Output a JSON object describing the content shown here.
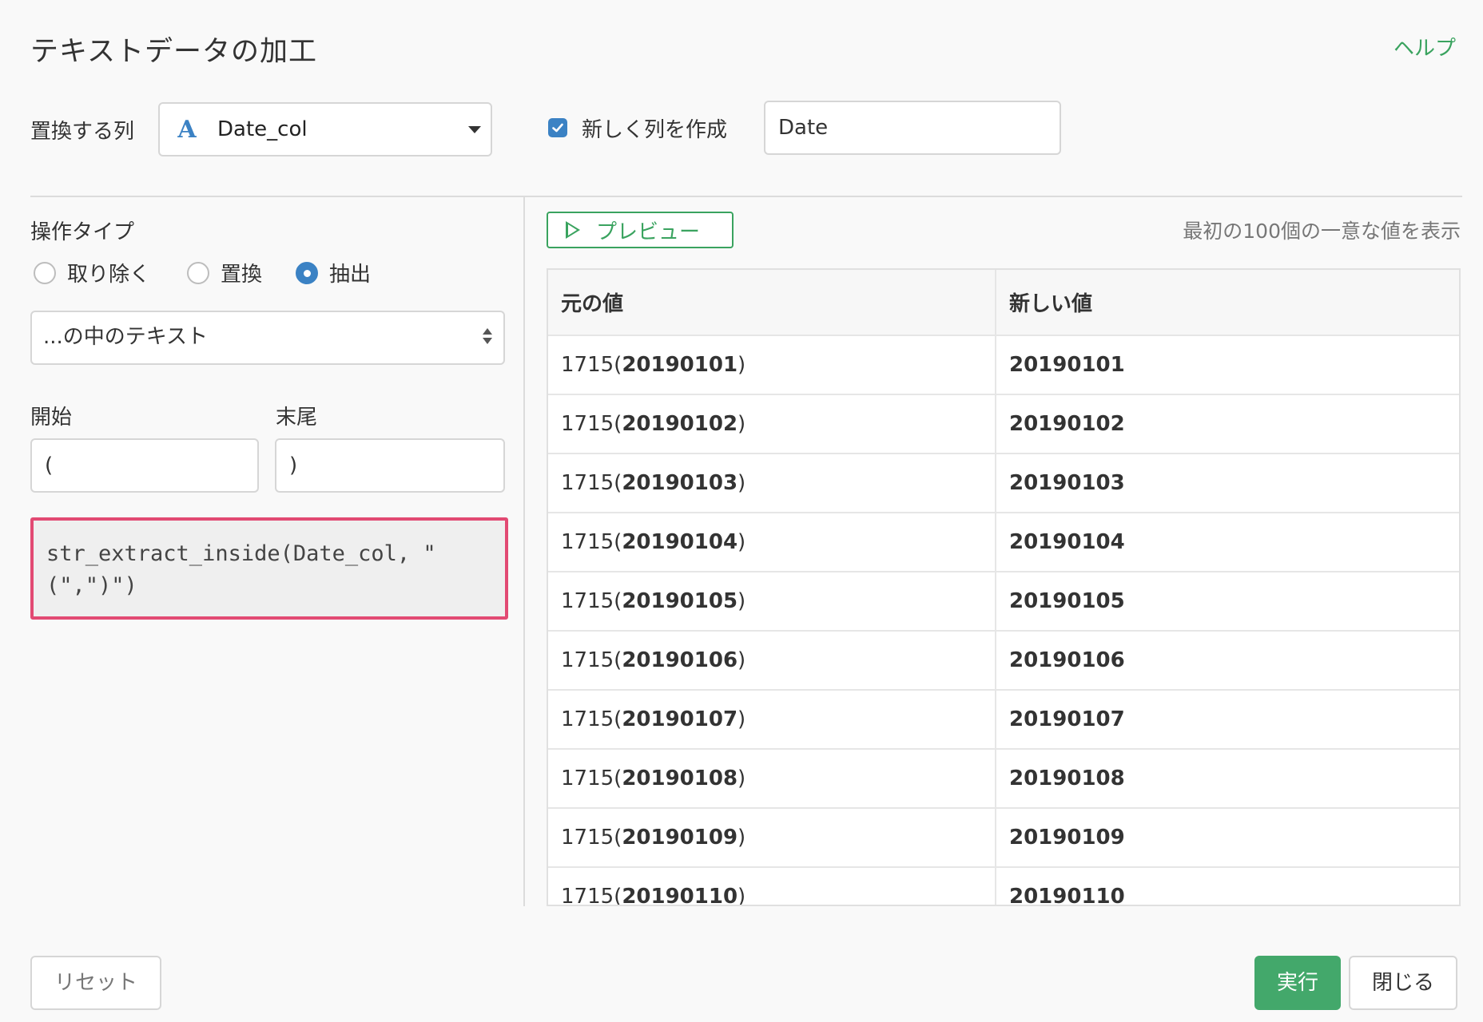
{
  "dialog": {
    "title": "テキストデータの加工",
    "help_label": "ヘルプ"
  },
  "replace_column": {
    "label": "置換する列",
    "type_icon": "A",
    "selected": "Date_col"
  },
  "new_column": {
    "checked": true,
    "label": "新しく列を作成",
    "value": "Date"
  },
  "operation": {
    "label": "操作タイプ",
    "options": [
      {
        "label": "取り除く",
        "selected": false
      },
      {
        "label": "置換",
        "selected": false
      },
      {
        "label": "抽出",
        "selected": true
      }
    ],
    "mode_selected": "...の中のテキスト"
  },
  "range": {
    "start_label": "開始",
    "start_value": "(",
    "end_label": "末尾",
    "end_value": ")"
  },
  "code": "str_extract_inside(Date_col, \"(\",\")\")",
  "preview": {
    "button_label": "プレビュー",
    "note": "最初の100個の一意な値を表示",
    "columns": [
      "元の値",
      "新しい値"
    ],
    "rows": [
      {
        "prefix": "1715(",
        "inner": "20190101",
        "suffix": ")",
        "new": "20190101"
      },
      {
        "prefix": "1715(",
        "inner": "20190102",
        "suffix": ")",
        "new": "20190102"
      },
      {
        "prefix": "1715(",
        "inner": "20190103",
        "suffix": ")",
        "new": "20190103"
      },
      {
        "prefix": "1715(",
        "inner": "20190104",
        "suffix": ")",
        "new": "20190104"
      },
      {
        "prefix": "1715(",
        "inner": "20190105",
        "suffix": ")",
        "new": "20190105"
      },
      {
        "prefix": "1715(",
        "inner": "20190106",
        "suffix": ")",
        "new": "20190106"
      },
      {
        "prefix": "1715(",
        "inner": "20190107",
        "suffix": ")",
        "new": "20190107"
      },
      {
        "prefix": "1715(",
        "inner": "20190108",
        "suffix": ")",
        "new": "20190108"
      },
      {
        "prefix": "1715(",
        "inner": "20190109",
        "suffix": ")",
        "new": "20190109"
      },
      {
        "prefix": "1715(",
        "inner": "20190110",
        "suffix": ")",
        "new": "20190110"
      }
    ]
  },
  "footer": {
    "reset_label": "リセット",
    "run_label": "実行",
    "close_label": "閉じる"
  },
  "colors": {
    "accent_green": "#43a86b",
    "accent_blue": "#3b82c4",
    "highlight_pink": "#e24a73"
  }
}
